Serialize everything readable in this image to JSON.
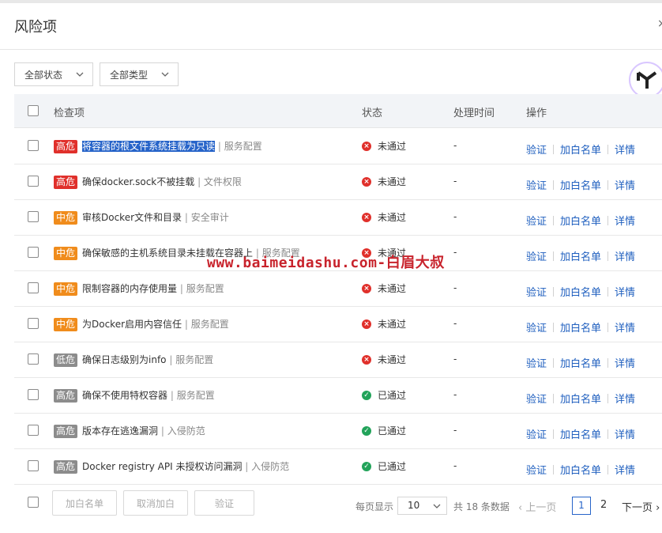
{
  "dialog": {
    "title": "风险项",
    "close_glyph": "×"
  },
  "filters": {
    "status": "全部状态",
    "type": "全部类型"
  },
  "table": {
    "columns": {
      "check": "检查项",
      "status": "状态",
      "time": "处理时间",
      "actions": "操作"
    },
    "actions": {
      "verify": "验证",
      "whitelist": "加白名单",
      "details": "详情"
    },
    "rows": [
      {
        "level": "高危",
        "name": "将容器的根文件系统挂载为只读",
        "category": "服务配置",
        "status": "未通过",
        "time": "-"
      },
      {
        "level": "高危",
        "name": "确保docker.sock不被挂载",
        "category": "文件权限",
        "status": "未通过",
        "time": "-"
      },
      {
        "level": "中危",
        "name": "审核Docker文件和目录",
        "category": "安全审计",
        "status": "未通过",
        "time": "-"
      },
      {
        "level": "中危",
        "name": "确保敏感的主机系统目录未挂载在容器上",
        "category": "服务配置",
        "status": "未通过",
        "time": "-"
      },
      {
        "level": "中危",
        "name": "限制容器的内存使用量",
        "category": "服务配置",
        "status": "未通过",
        "time": "-"
      },
      {
        "level": "中危",
        "name": "为Docker启用内容信任",
        "category": "服务配置",
        "status": "未通过",
        "time": "-"
      },
      {
        "level": "低危",
        "name": "确保日志级别为info",
        "category": "服务配置",
        "status": "未通过",
        "time": "-"
      },
      {
        "level": "高危",
        "name": "确保不使用特权容器",
        "category": "服务配置",
        "status": "已通过",
        "time": "-"
      },
      {
        "level": "高危",
        "name": "版本存在逃逸漏洞",
        "category": "入侵防范",
        "status": "已通过",
        "time": "-"
      },
      {
        "level": "高危",
        "name": "Docker registry API 未授权访问漏洞",
        "category": "入侵防范",
        "status": "已通过",
        "time": "-"
      }
    ]
  },
  "watermark": "www.baimeidashu.com-白眉大叔",
  "footer": {
    "add_whitelist": "加白名单",
    "cancel_whitelist": "取消加白",
    "verify": "验证",
    "per_page_label": "每页显示",
    "per_page_value": "10",
    "total_text": "共 18 条数据",
    "prev": "上一页",
    "page1": "1",
    "page2": "2",
    "next": "下一页"
  },
  "colors": {
    "high": "#e0302b",
    "mid": "#f08c1c",
    "gray": "#8c8c8c",
    "link": "#1f5fbf",
    "pass": "#22a35a"
  }
}
